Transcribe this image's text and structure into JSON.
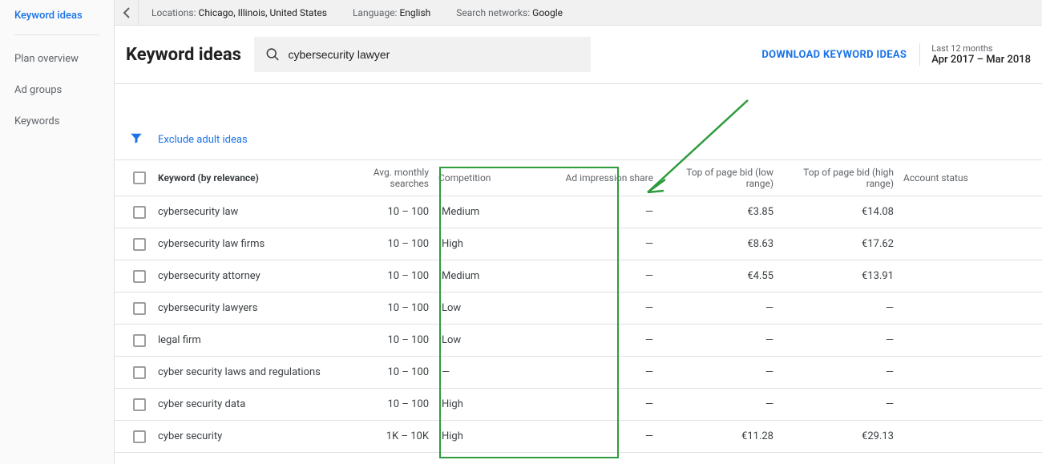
{
  "sidebar": {
    "items": [
      {
        "label": "Keyword ideas",
        "active": true
      },
      {
        "label": "Plan overview",
        "active": false
      },
      {
        "label": "Ad groups",
        "active": false
      },
      {
        "label": "Keywords",
        "active": false
      }
    ]
  },
  "targeting": {
    "locations_label": "Locations:",
    "locations_value": "Chicago, Illinois, United States",
    "language_label": "Language:",
    "language_value": "English",
    "networks_label": "Search networks:",
    "networks_value": "Google"
  },
  "header": {
    "title": "Keyword ideas",
    "search_value": "cybersecurity lawyer",
    "download_label": "DOWNLOAD KEYWORD IDEAS",
    "date_small": "Last 12 months",
    "date_range": "Apr 2017 – Mar 2018"
  },
  "filter": {
    "exclude_label": "Exclude adult ideas"
  },
  "columns": {
    "keyword": "Keyword (by relevance)",
    "searches": "Avg. monthly searches",
    "competition": "Competition",
    "impression": "Ad impression share",
    "bid_low": "Top of page bid (low range)",
    "bid_high": "Top of page bid (high range)",
    "account": "Account status"
  },
  "rows": [
    {
      "keyword": "cybersecurity law",
      "searches": "10 – 100",
      "competition": "Medium",
      "impression": "—",
      "bid_low": "€3.85",
      "bid_high": "€14.08",
      "account": ""
    },
    {
      "keyword": "cybersecurity law firms",
      "searches": "10 – 100",
      "competition": "High",
      "impression": "—",
      "bid_low": "€8.63",
      "bid_high": "€17.62",
      "account": ""
    },
    {
      "keyword": "cybersecurity attorney",
      "searches": "10 – 100",
      "competition": "Medium",
      "impression": "—",
      "bid_low": "€4.55",
      "bid_high": "€13.91",
      "account": ""
    },
    {
      "keyword": "cybersecurity lawyers",
      "searches": "10 – 100",
      "competition": "Low",
      "impression": "—",
      "bid_low": "—",
      "bid_high": "—",
      "account": ""
    },
    {
      "keyword": "legal firm",
      "searches": "10 – 100",
      "competition": "Low",
      "impression": "—",
      "bid_low": "—",
      "bid_high": "—",
      "account": ""
    },
    {
      "keyword": "cyber security laws and regulations",
      "searches": "10 – 100",
      "competition": "—",
      "impression": "—",
      "bid_low": "—",
      "bid_high": "—",
      "account": ""
    },
    {
      "keyword": "cyber security data",
      "searches": "10 – 100",
      "competition": "High",
      "impression": "—",
      "bid_low": "—",
      "bid_high": "—",
      "account": ""
    },
    {
      "keyword": "cyber security",
      "searches": "1K – 10K",
      "competition": "High",
      "impression": "—",
      "bid_low": "€11.28",
      "bid_high": "€29.13",
      "account": ""
    }
  ]
}
